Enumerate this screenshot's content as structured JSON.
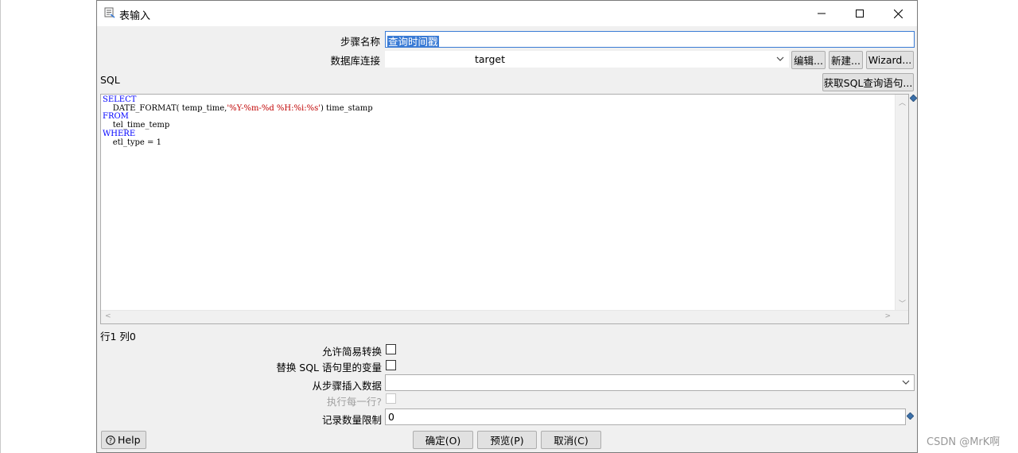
{
  "window": {
    "title": "表输入"
  },
  "form": {
    "step_name_label": "步骤名称",
    "step_name_value": "查询时间戳",
    "db_conn_label": "数据库连接",
    "db_conn_value": "target",
    "edit_btn": "编辑...",
    "new_btn": "新建...",
    "wizard_btn": "Wizard...",
    "sql_label": "SQL",
    "get_sql_btn": "获取SQL查询语句..."
  },
  "sql": {
    "lines": [
      {
        "kw": "SELECT"
      },
      {
        "text": "    DATE_FORMAT( temp_time,",
        "str": "'%Y-%m-%d %H:%i:%s'",
        "rest": ") time_stamp"
      },
      {
        "kw": "FROM"
      },
      {
        "text": "    tel_time_temp"
      },
      {
        "kw": "WHERE"
      },
      {
        "text": "    etl_type = 1"
      }
    ]
  },
  "status": {
    "position": "行1 列0"
  },
  "options": {
    "lazy_convert_label": "允许简易转换",
    "replace_vars_label": "替换 SQL 语句里的变量",
    "insert_from_step_label": "从步骤插入数据",
    "insert_from_step_value": "",
    "execute_each_row_label": "执行每一行?",
    "limit_label": "记录数量限制",
    "limit_value": "0"
  },
  "buttons": {
    "help": "Help",
    "ok": "确定(O)",
    "preview": "预览(P)",
    "cancel": "取消(C)"
  },
  "watermark": "CSDN @MrK啊",
  "colors": {
    "keyword": "#0000ff",
    "string": "#c00000",
    "selection": "#3a7bd5"
  }
}
